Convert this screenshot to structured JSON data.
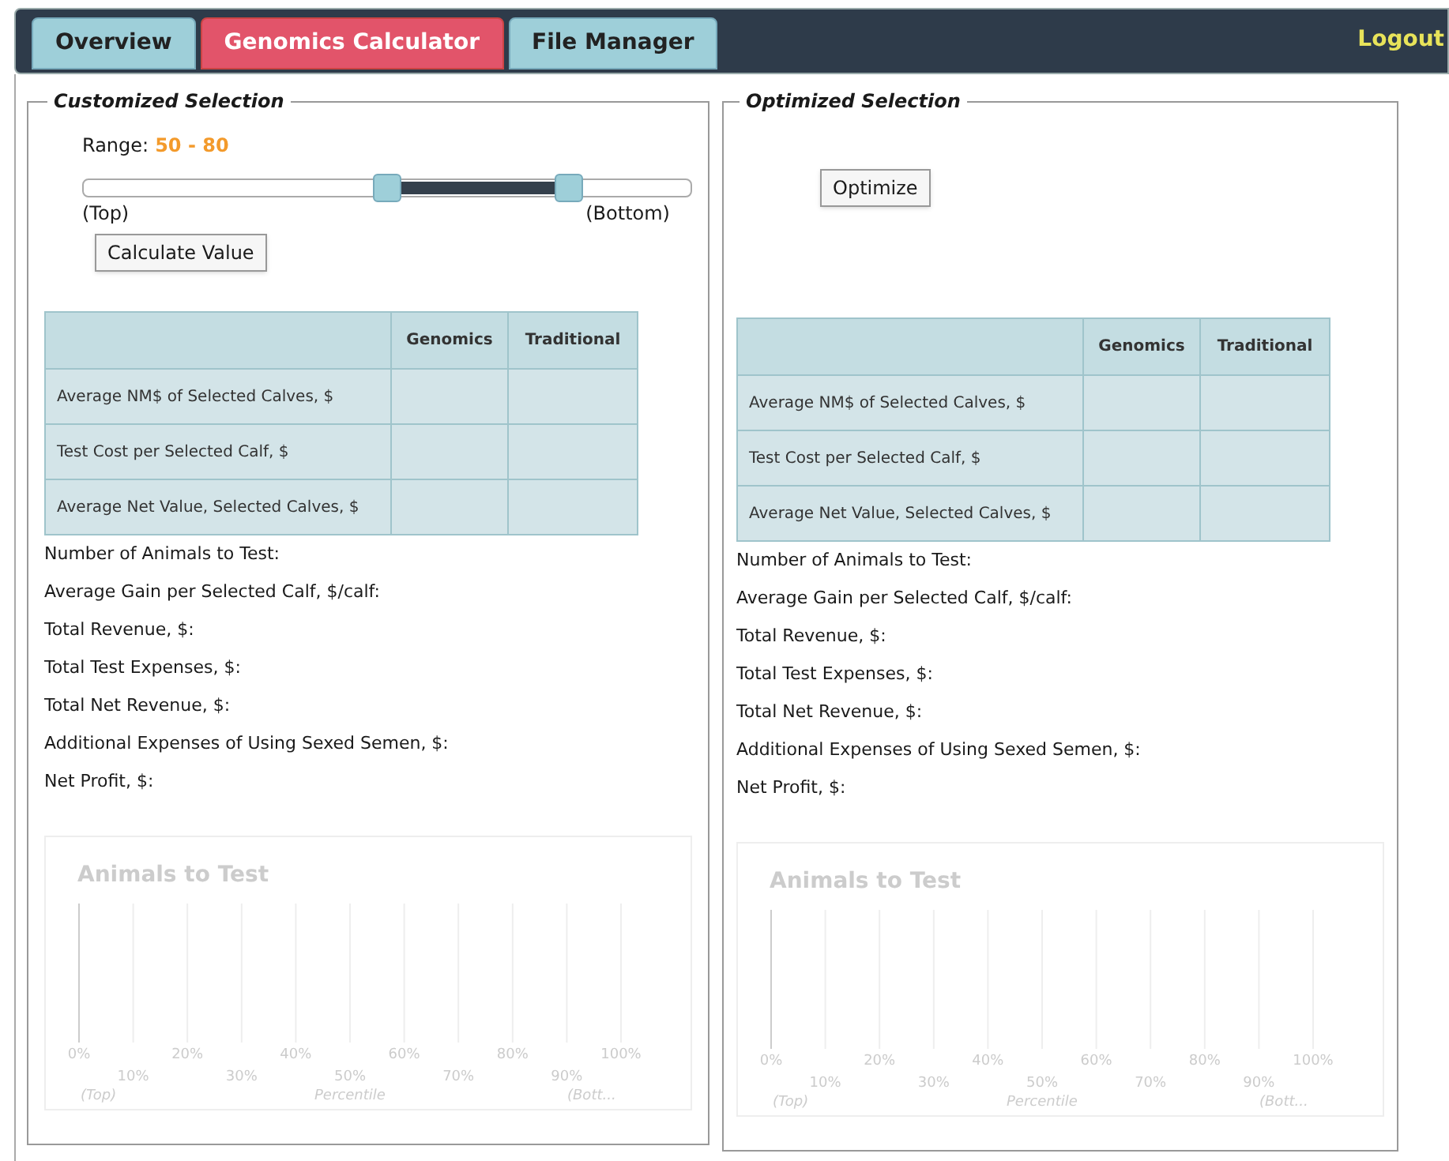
{
  "nav": {
    "tabs": [
      {
        "label": "Overview",
        "selected": false
      },
      {
        "label": "Genomics Calculator",
        "selected": true
      },
      {
        "label": "File Manager",
        "selected": false
      }
    ],
    "logout": "Logout"
  },
  "panels": [
    {
      "kind": "custom",
      "title": "Customized Selection",
      "range_label": "Range:",
      "range_value": "50 - 80",
      "slider": {
        "low": {
          "level": 0.5
        },
        "high": {
          "level": 0.8
        },
        "left_label": "(Top)",
        "right_label": "(Bottom)"
      },
      "button": "Calculate Value",
      "table": {
        "columns": [
          "",
          "Genomics",
          "Traditional"
        ],
        "rows": [
          "Average NM$ of Selected Calves, $",
          "Test Cost per Selected Calf, $",
          "Average Net Value, Selected Calves, $"
        ]
      },
      "results": [
        "Number of Animals to Test:",
        "Average Gain per Selected Calf, $/calf:",
        "Total Revenue, $:",
        "Total Test Expenses, $:",
        "Total Net Revenue, $:",
        "Additional Expenses of Using Sexed Semen, $:",
        "Net Profit, $:"
      ],
      "chart": {
        "title": "Animals to Test",
        "ticks": [
          "0%",
          "10%",
          "20%",
          "30%",
          "40%",
          "50%",
          "60%",
          "70%",
          "80%",
          "90%",
          "100%"
        ],
        "left_label": "(Top)",
        "xlabel": "Percentile",
        "right_label": "(Bott..."
      }
    },
    {
      "kind": "optimized",
      "title": "Optimized Selection",
      "button": "Optimize",
      "table": {
        "columns": [
          "",
          "Genomics",
          "Traditional"
        ],
        "rows": [
          "Average NM$ of Selected Calves, $",
          "Test Cost per Selected Calf, $",
          "Average Net Value, Selected Calves, $"
        ]
      },
      "results": [
        "Number of Animals to Test:",
        "Average Gain per Selected Calf, $/calf:",
        "Total Revenue, $:",
        "Total Test Expenses, $:",
        "Total Net Revenue, $:",
        "Additional Expenses of Using Sexed Semen, $:",
        "Net Profit, $:"
      ],
      "chart": {
        "title": "Animals to Test",
        "ticks": [
          "0%",
          "10%",
          "20%",
          "30%",
          "40%",
          "50%",
          "60%",
          "70%",
          "80%",
          "90%",
          "100%"
        ],
        "left_label": "(Top)",
        "xlabel": "Percentile",
        "right_label": "(Bott..."
      }
    }
  ]
}
